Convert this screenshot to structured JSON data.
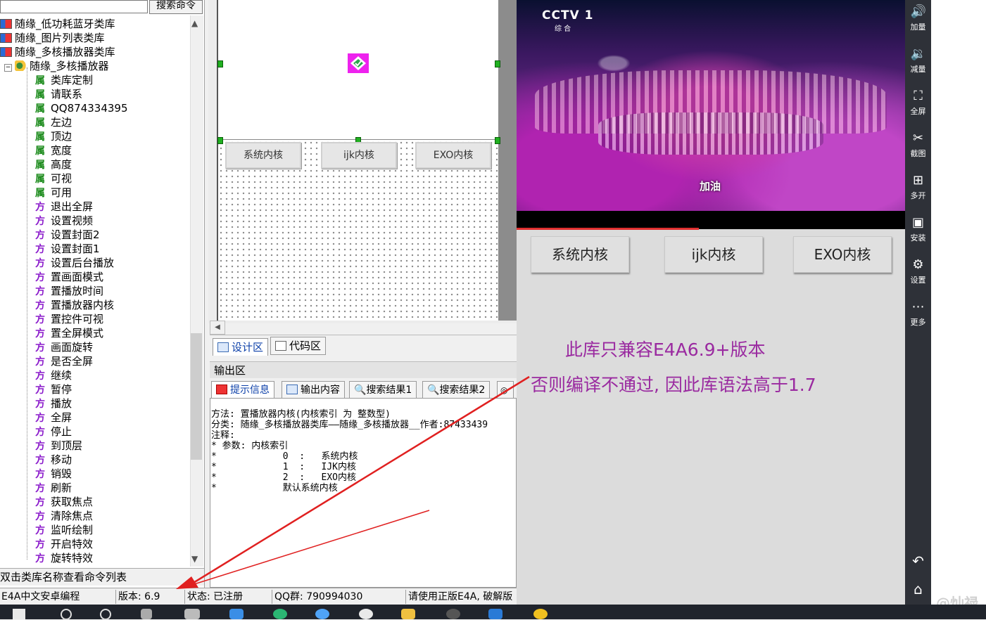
{
  "search": {
    "button_label": "搜索命令"
  },
  "tree": {
    "libraries": [
      "随缘_低功耗蓝牙类库",
      "随缘_图片列表类库",
      "随缘_多核播放器类库"
    ],
    "root_label": "随缘_多核播放器",
    "properties_icon": "属",
    "methods_icon": "方",
    "properties": [
      "类库定制",
      "请联系",
      "QQ874334395",
      "左边",
      "顶边",
      "宽度",
      "高度",
      "可视",
      "可用"
    ],
    "methods": [
      "退出全屏",
      "设置视频",
      "设置封面2",
      "设置封面1",
      "设置后台播放",
      "置画面模式",
      "置播放时间",
      "置播放器内核",
      "置控件可视",
      "置全屏模式",
      "画面旋转",
      "是否全屏",
      "继续",
      "暂停",
      "播放",
      "全屏",
      "停止",
      "到顶层",
      "移动",
      "销毁",
      "刷新",
      "获取焦点",
      "清除焦点",
      "监听绘制",
      "开启特效",
      "旋转特效"
    ]
  },
  "hint": "双击类库名称查看命令列表",
  "statusbar": {
    "app": "E4A中文安卓编程",
    "version": "版本: 6.9",
    "state": "状态: 已注册",
    "qq": "QQ群: 790994030",
    "notice": "请使用正版E4A, 破解版"
  },
  "designer": {
    "buttons": [
      "系统内核",
      "ijk内核",
      "EXO内核"
    ]
  },
  "editor_tabs": [
    "设计区",
    "代码区"
  ],
  "output": {
    "title": "输出区",
    "tabs": [
      "提示信息",
      "输出内容",
      "搜索结果1",
      "搜索结果2"
    ],
    "lines": [
      "方法: 置播放器内核(内核索引 为 整数型)",
      "分类: 随缘_多核播放器类库——随缘_多核播放器__作者:87433439",
      "注释:",
      "* 参数: 内核索引",
      "*            0  :   系统内核",
      "*            1  :   IJK内核",
      "*            2  :   EXO内核",
      "*            默认系统内核"
    ]
  },
  "phone": {
    "channel": "CCTV 1",
    "channel_sub": "综 合",
    "caption": "加油",
    "buttons": [
      "系统内核",
      "ijk内核",
      "EXO内核"
    ],
    "note_line1": "此库只兼容E4A6.9+版本",
    "note_line2": "否则编译不通过, 因此库语法高于1.7",
    "progress": 0.47
  },
  "emulator_toolbar": [
    {
      "icon": "volume-up-icon",
      "glyph": "🔊",
      "label": "加量"
    },
    {
      "icon": "volume-down-icon",
      "glyph": "🔉",
      "label": "减量"
    },
    {
      "icon": "fullscreen-icon",
      "glyph": "⛶",
      "label": "全屏"
    },
    {
      "icon": "scissors-icon",
      "glyph": "✂",
      "label": "截图"
    },
    {
      "icon": "multi-open-icon",
      "glyph": "⊞",
      "label": "多开"
    },
    {
      "icon": "apk-install-icon",
      "glyph": "▣",
      "label": "安装"
    },
    {
      "icon": "gear-icon",
      "glyph": "⚙",
      "label": "设置"
    },
    {
      "icon": "more-icon",
      "glyph": "⋯",
      "label": "更多"
    }
  ],
  "watermark": "@灿禄",
  "colors": {
    "note": "#9a2aa0",
    "arrow": "#e02020",
    "toolbar": "#2e3138"
  }
}
